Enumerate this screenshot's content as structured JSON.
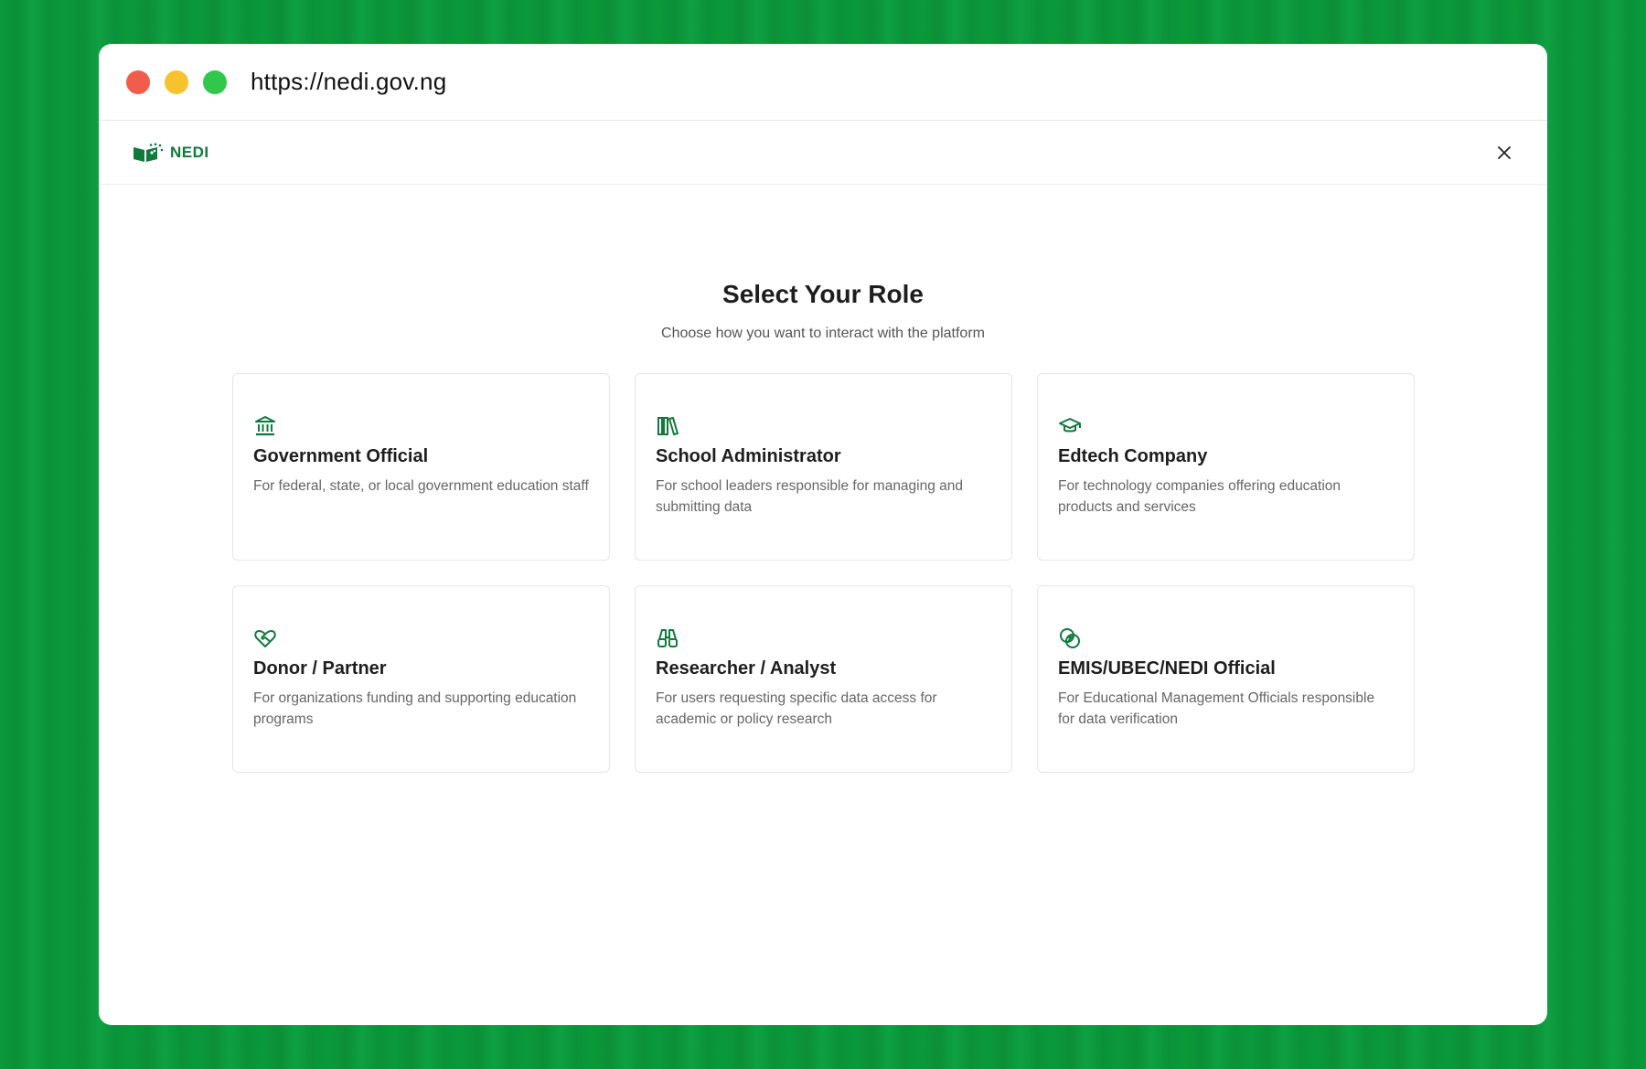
{
  "browser": {
    "url": "https://nedi.gov.ng"
  },
  "header": {
    "logo_text": "NEDI"
  },
  "main": {
    "title": "Select Your Role",
    "subtitle": "Choose how you want to interact with the platform",
    "roles": [
      {
        "icon": "bank-icon",
        "title": "Government Official",
        "description": "For federal, state, or local government education staff"
      },
      {
        "icon": "books-icon",
        "title": "School Administrator",
        "description": "For school leaders responsible for managing and submitting data"
      },
      {
        "icon": "graduation-cap-icon",
        "title": "Edtech Company",
        "description": "For technology companies offering education products and services"
      },
      {
        "icon": "heart-handshake-icon",
        "title": "Donor / Partner",
        "description": "For organizations funding and supporting education programs"
      },
      {
        "icon": "binoculars-icon",
        "title": "Researcher / Analyst",
        "description": "For users requesting specific data access for academic or policy research"
      },
      {
        "icon": "overlapping-circles-icon",
        "title": "EMIS/UBEC/NEDI Official",
        "description": "For Educational Management Officials responsible for data verification"
      }
    ]
  },
  "colors": {
    "accent": "#0f7a3b",
    "background": "#0a9a3a"
  }
}
